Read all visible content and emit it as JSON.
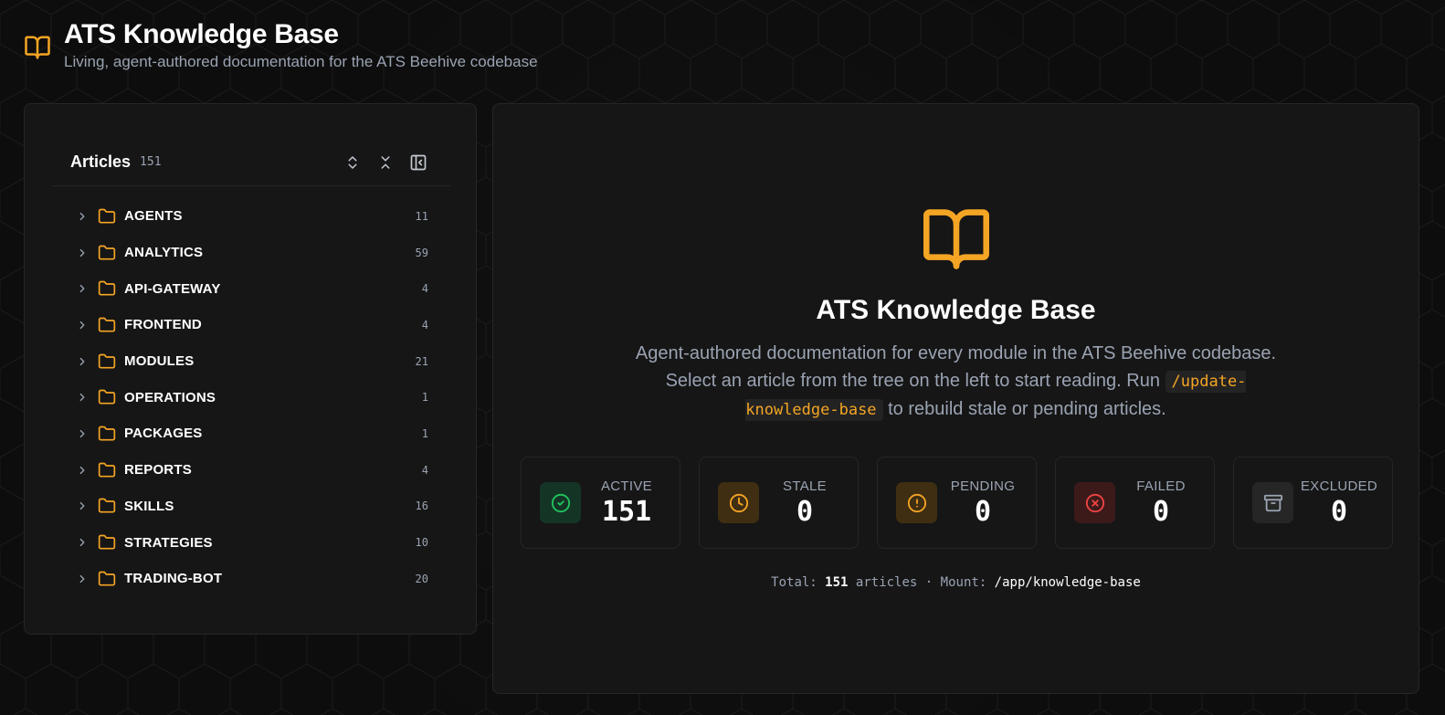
{
  "header": {
    "title": "ATS Knowledge Base",
    "subtitle": "Living, agent-authored documentation for the ATS Beehive codebase"
  },
  "sidebar": {
    "title": "Articles",
    "count": "151",
    "items": [
      {
        "label": "AGENTS",
        "count": "11"
      },
      {
        "label": "ANALYTICS",
        "count": "59"
      },
      {
        "label": "API-GATEWAY",
        "count": "4"
      },
      {
        "label": "FRONTEND",
        "count": "4"
      },
      {
        "label": "MODULES",
        "count": "21"
      },
      {
        "label": "OPERATIONS",
        "count": "1"
      },
      {
        "label": "PACKAGES",
        "count": "1"
      },
      {
        "label": "REPORTS",
        "count": "4"
      },
      {
        "label": "SKILLS",
        "count": "16"
      },
      {
        "label": "STRATEGIES",
        "count": "10"
      },
      {
        "label": "TRADING-BOT",
        "count": "20"
      }
    ]
  },
  "hero": {
    "title": "ATS Knowledge Base",
    "desc_before": "Agent-authored documentation for every module in the ATS Beehive codebase. Select an article from the tree on the left to start reading. Run",
    "command": "/update-knowledge-base",
    "desc_after": "to rebuild stale or pending articles."
  },
  "stats": [
    {
      "label": "ACTIVE",
      "value": "151",
      "icon": "check-circle-icon",
      "color": "#22c55e",
      "bg": "#143526"
    },
    {
      "label": "STALE",
      "value": "0",
      "icon": "clock-icon",
      "color": "#f5a524",
      "bg": "#3f2e12"
    },
    {
      "label": "PENDING",
      "value": "0",
      "icon": "alert-circle-icon",
      "color": "#f5a524",
      "bg": "#3f2e12"
    },
    {
      "label": "FAILED",
      "value": "0",
      "icon": "x-circle-icon",
      "color": "#ef4444",
      "bg": "#3d1a1a"
    },
    {
      "label": "EXCLUDED",
      "value": "0",
      "icon": "archive-icon",
      "color": "#9aa3b2",
      "bg": "#262626"
    }
  ],
  "footer": {
    "total_label": "Total:",
    "total_value": "151",
    "articles_label": "articles",
    "separator": "·",
    "mount_label": "Mount:",
    "mount_path": "/app/knowledge-base"
  },
  "colors": {
    "accent": "#f5a524",
    "background": "#0d0d0d",
    "panel": "#161616"
  }
}
